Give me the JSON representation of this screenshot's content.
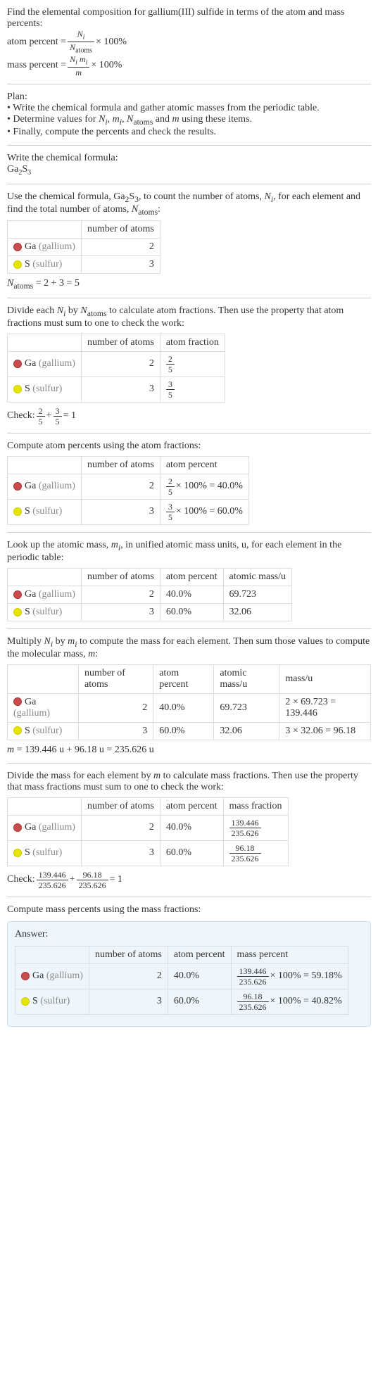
{
  "intro": {
    "title": "Find the elemental composition for gallium(III) sulfide in terms of the atom and mass percents:",
    "atom_percent_label": "atom percent = ",
    "atom_percent_frac_num": "N_i",
    "atom_percent_frac_den": "N_atoms",
    "times100": " × 100%",
    "mass_percent_label": "mass percent = ",
    "mass_percent_frac_num": "N_i m_i",
    "mass_percent_frac_den": "m"
  },
  "plan": {
    "title": "Plan:",
    "b1": "• Write the chemical formula and gather atomic masses from the periodic table.",
    "b2_pre": "• Determine values for ",
    "b2_vars": "N_i, m_i, N_atoms",
    "b2_mid": " and ",
    "b2_var_m": "m",
    "b2_post": " using these items.",
    "b3": "• Finally, compute the percents and check the results."
  },
  "step_formula": {
    "title": "Write the chemical formula:",
    "formula": "Ga",
    "sub1": "2",
    "formula2": "S",
    "sub2": "3"
  },
  "step_count": {
    "text_pre": "Use the chemical formula, Ga",
    "sub1": "2",
    "text_mid1": "S",
    "sub2": "3",
    "text_mid2": ", to count the number of atoms, ",
    "var_ni": "N_i",
    "text_mid3": ", for each element and find the total number of atoms, ",
    "var_na": "N_atoms",
    "text_post": ":",
    "th_count": "number of atoms",
    "ga_label": "Ga",
    "ga_name": " (gallium)",
    "ga_count": "2",
    "s_label": "S",
    "s_name": " (sulfur)",
    "s_count": "3",
    "sum_eq": "N_atoms = 2 + 3 = 5"
  },
  "step_frac": {
    "text_pre": "Divide each ",
    "var_ni": "N_i",
    "text_mid1": " by ",
    "var_na": "N_atoms",
    "text_post": " to calculate atom fractions. Then use the property that atom fractions must sum to one to check the work:",
    "th_count": "number of atoms",
    "th_frac": "atom fraction",
    "ga_count": "2",
    "ga_frac_num": "2",
    "ga_frac_den": "5",
    "s_count": "3",
    "s_frac_num": "3",
    "s_frac_den": "5",
    "check_label": "Check: ",
    "check_f1n": "2",
    "check_f1d": "5",
    "check_plus": " + ",
    "check_f2n": "3",
    "check_f2d": "5",
    "check_eq": " = 1"
  },
  "step_pct": {
    "title": "Compute atom percents using the atom fractions:",
    "th_count": "number of atoms",
    "th_pct": "atom percent",
    "ga_count": "2",
    "ga_frac_num": "2",
    "ga_frac_den": "5",
    "ga_eq": " × 100% = 40.0%",
    "s_count": "3",
    "s_frac_num": "3",
    "s_frac_den": "5",
    "s_eq": " × 100% = 60.0%"
  },
  "step_mass": {
    "text_pre": "Look up the atomic mass, ",
    "var_mi": "m_i",
    "text_post": ", in unified atomic mass units, u, for each element in the periodic table:",
    "th_count": "number of atoms",
    "th_pct": "atom percent",
    "th_mass": "atomic mass/u",
    "ga_count": "2",
    "ga_pct": "40.0%",
    "ga_mass": "69.723",
    "s_count": "3",
    "s_pct": "60.0%",
    "s_mass": "32.06"
  },
  "step_mult": {
    "text_pre": "Multiply ",
    "var_ni": "N_i",
    "text_mid1": " by ",
    "var_mi": "m_i",
    "text_mid2": " to compute the mass for each element. Then sum those values to compute the molecular mass, ",
    "var_m": "m",
    "text_post": ":",
    "th_count": "number of atoms",
    "th_pct": "atom percent",
    "th_amass": "atomic mass/u",
    "th_mass": "mass/u",
    "ga_count": "2",
    "ga_pct": "40.0%",
    "ga_amass": "69.723",
    "ga_mass": "2 × 69.723 = 139.446",
    "s_count": "3",
    "s_pct": "60.0%",
    "s_amass": "32.06",
    "s_mass": "3 × 32.06 = 96.18",
    "sum_eq": "m = 139.446 u + 96.18 u = 235.626 u"
  },
  "step_mfrac": {
    "text_pre": "Divide the mass for each element by ",
    "var_m": "m",
    "text_post": " to calculate mass fractions. Then use the property that mass fractions must sum to one to check the work:",
    "th_count": "number of atoms",
    "th_pct": "atom percent",
    "th_mfrac": "mass fraction",
    "ga_count": "2",
    "ga_pct": "40.0%",
    "ga_fn": "139.446",
    "ga_fd": "235.626",
    "s_count": "3",
    "s_pct": "60.0%",
    "s_fn": "96.18",
    "s_fd": "235.626",
    "check_label": "Check: ",
    "check_f1n": "139.446",
    "check_f1d": "235.626",
    "check_plus": " + ",
    "check_f2n": "96.18",
    "check_f2d": "235.626",
    "check_eq": " = 1"
  },
  "step_mpct": {
    "title": "Compute mass percents using the mass fractions:"
  },
  "answer": {
    "title": "Answer:",
    "th_count": "number of atoms",
    "th_apct": "atom percent",
    "th_mpct": "mass percent",
    "ga_count": "2",
    "ga_apct": "40.0%",
    "ga_fn": "139.446",
    "ga_fd": "235.626",
    "ga_eq": " × 100% = 59.18%",
    "s_count": "3",
    "s_apct": "60.0%",
    "s_fn": "96.18",
    "s_fd": "235.626",
    "s_eq": " × 100% = 40.82%"
  },
  "common": {
    "ga_label": "Ga",
    "ga_name": " (gallium)",
    "s_label": "S",
    "s_name": " (sulfur)"
  }
}
